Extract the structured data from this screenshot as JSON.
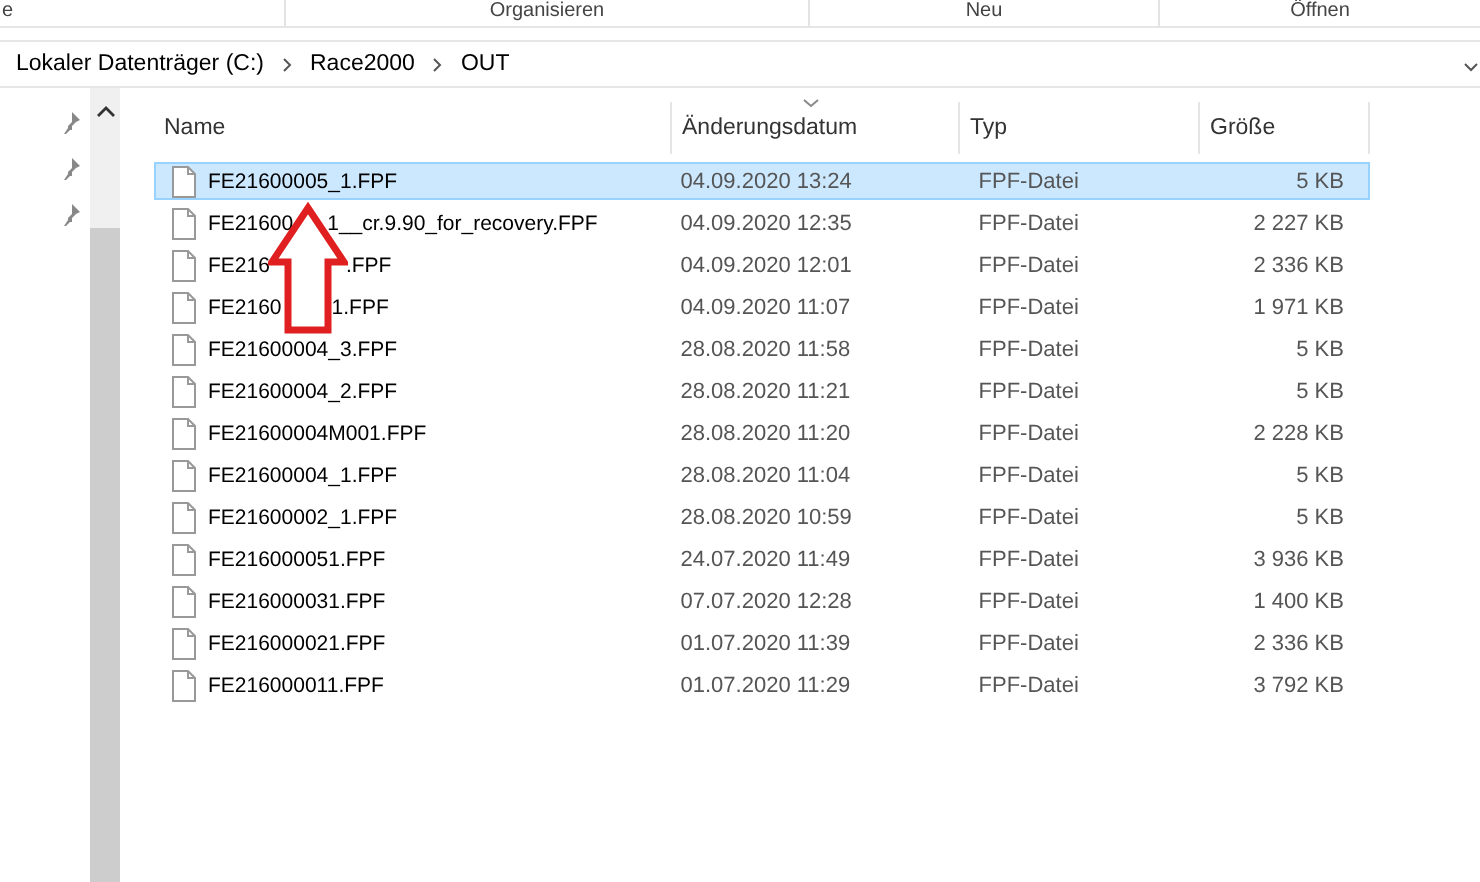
{
  "ribbon": {
    "groups": [
      "e",
      "Organisieren",
      "Neu",
      "Öffnen"
    ]
  },
  "address_bar": {
    "path": [
      "Lokaler Datenträger (C:)",
      "Race2000",
      "OUT"
    ]
  },
  "columns": [
    "Name",
    "Änderungsdatum",
    "Typ",
    "Größe"
  ],
  "files": [
    {
      "name": [
        "FE21600005_1.FPF"
      ],
      "date": "04.09.2020 13:24",
      "type": "FPF-Datei",
      "size": "5 KB",
      "selected": true
    },
    {
      "name": [
        "FE21600",
        "1__cr.9.90_for_recovery.FPF"
      ],
      "date": "04.09.2020 12:35",
      "type": "FPF-Datei",
      "size": "2 227 KB",
      "selected": false
    },
    {
      "name": [
        "FE216",
        ".FPF"
      ],
      "date": "04.09.2020 12:01",
      "type": "FPF-Datei",
      "size": "2 336 KB",
      "selected": false
    },
    {
      "name": [
        "FE2160",
        "1.FPF"
      ],
      "date": "04.09.2020 11:07",
      "type": "FPF-Datei",
      "size": "1 971 KB",
      "selected": false
    },
    {
      "name": [
        "FE21600004_3.FPF"
      ],
      "date": "28.08.2020 11:58",
      "type": "FPF-Datei",
      "size": "5 KB",
      "selected": false
    },
    {
      "name": [
        "FE21600004_2.FPF"
      ],
      "date": "28.08.2020 11:21",
      "type": "FPF-Datei",
      "size": "5 KB",
      "selected": false
    },
    {
      "name": [
        "FE21600004M001.FPF"
      ],
      "date": "28.08.2020 11:20",
      "type": "FPF-Datei",
      "size": "2 228 KB",
      "selected": false
    },
    {
      "name": [
        "FE21600004_1.FPF"
      ],
      "date": "28.08.2020 11:04",
      "type": "FPF-Datei",
      "size": "5 KB",
      "selected": false
    },
    {
      "name": [
        "FE21600002_1.FPF"
      ],
      "date": "28.08.2020 10:59",
      "type": "FPF-Datei",
      "size": "5 KB",
      "selected": false
    },
    {
      "name": [
        "FE216000051.FPF"
      ],
      "date": "24.07.2020 11:49",
      "type": "FPF-Datei",
      "size": "3 936 KB",
      "selected": false
    },
    {
      "name": [
        "FE216000031.FPF"
      ],
      "date": "07.07.2020 12:28",
      "type": "FPF-Datei",
      "size": "1 400 KB",
      "selected": false
    },
    {
      "name": [
        "FE216000021.FPF"
      ],
      "date": "01.07.2020 11:39",
      "type": "FPF-Datei",
      "size": "2 336 KB",
      "selected": false
    },
    {
      "name": [
        "FE216000011.FPF"
      ],
      "date": "01.07.2020 11:29",
      "type": "FPF-Datei",
      "size": "3 792 KB",
      "selected": false
    }
  ]
}
